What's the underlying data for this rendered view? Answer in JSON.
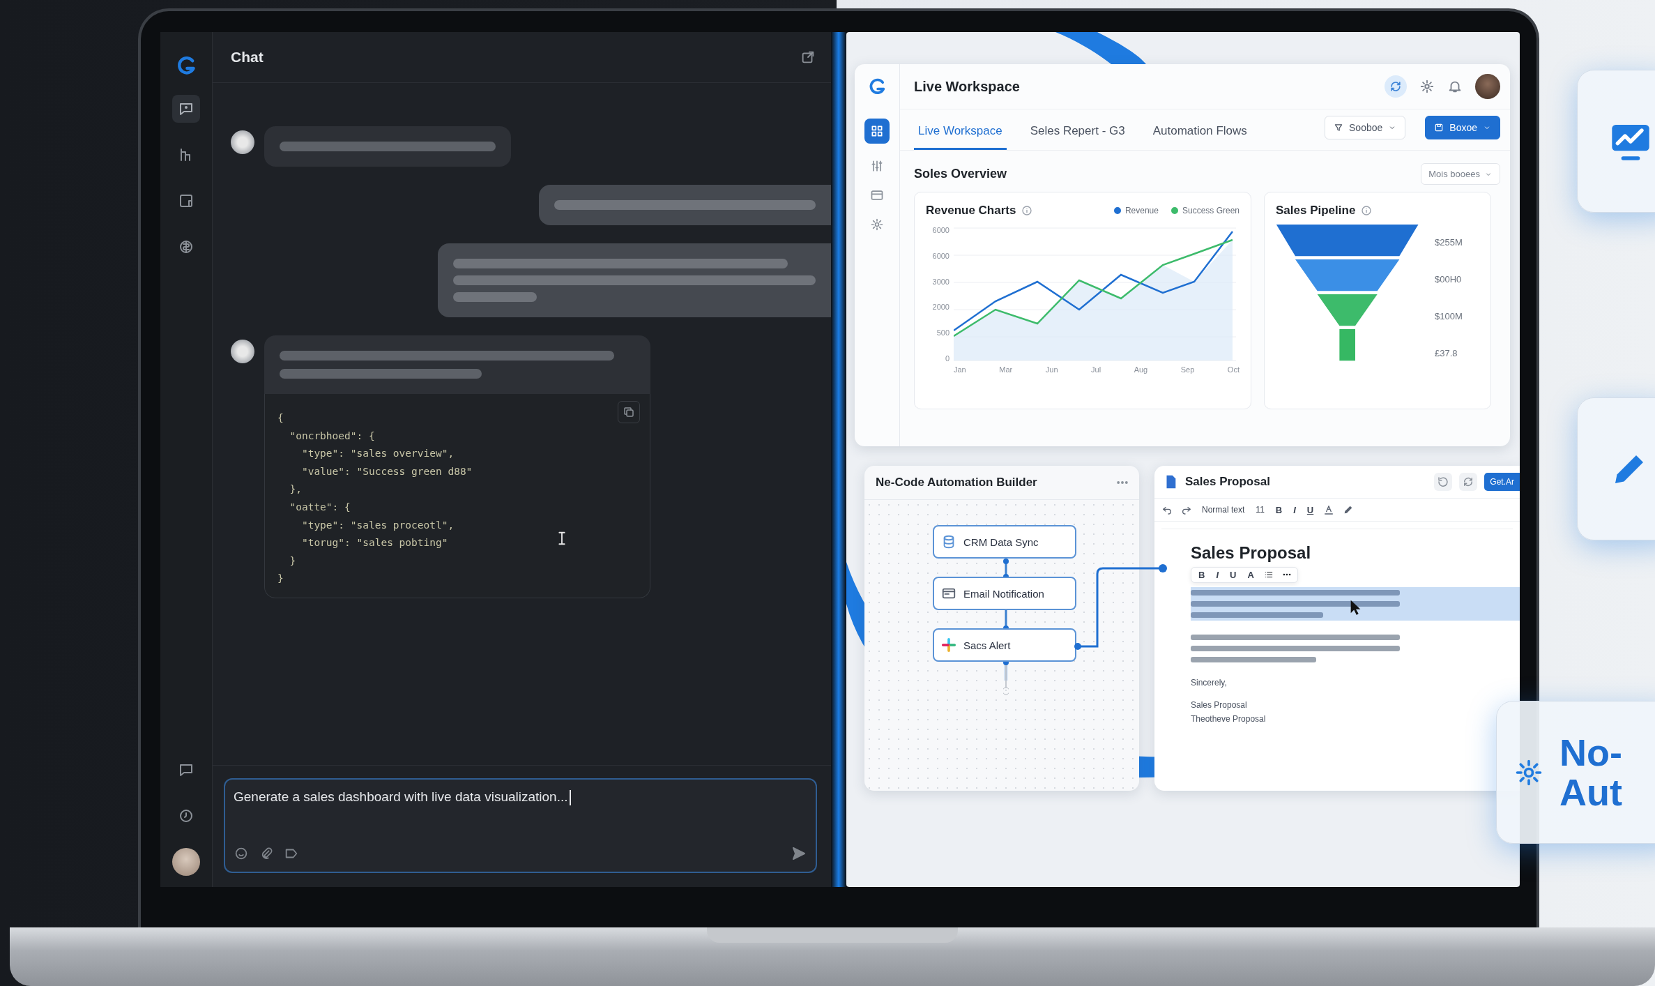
{
  "chat": {
    "title": "Chat",
    "messages": [
      {
        "kind": "assistant"
      },
      {
        "kind": "user"
      },
      {
        "kind": "user"
      },
      {
        "kind": "assistant",
        "code": [
          "{",
          "  \"oncrbhoed\": {",
          "    \"type\": \"sales overview\",",
          "    \"value\": \"Success green d88\"",
          "  },",
          "  \"oatte\": {",
          "    \"type\": \"sales proceotl\",",
          "    \"torug\": \"sales pobting\"",
          "  }",
          "}"
        ]
      }
    ],
    "composer": {
      "value": "Generate a sales dashboard with live data visualization..."
    }
  },
  "workspace": {
    "title": "Live Workspace",
    "tabs": [
      {
        "label": "Live Workspace",
        "selected": true
      },
      {
        "label": "Seles Repert - G3",
        "selected": false
      },
      {
        "label": "Automation Flows",
        "selected": false
      }
    ],
    "filter_button": "Sooboe",
    "primary_button": "Boxoe",
    "section_title": "Soles Overview",
    "section_select": "Mois booees",
    "revenue": {
      "title": "Revenue Charts",
      "legend": [
        {
          "label": "Revenue",
          "color": "#1f6fd1"
        },
        {
          "label": "Success Green",
          "color": "#3dbb6b"
        }
      ],
      "y_labels": [
        "6000",
        "6000",
        "3000",
        "2000",
        "500",
        "0"
      ],
      "x_labels": [
        "Jan",
        "Mar",
        "Jun",
        "Jul",
        "Aug",
        "Sep",
        "Oct"
      ]
    },
    "pipeline": {
      "title": "Sales Pipeline",
      "stages": [
        {
          "label": "$255M",
          "color": "#1f6fd1"
        },
        {
          "label": "$00H0",
          "color": "#3b8fe6"
        },
        {
          "label": "$100M",
          "color": "#3dbb6b"
        },
        {
          "label": "£37.8",
          "color": "#36b863"
        }
      ]
    },
    "automation": {
      "title": "Ne-Code Automation Builder",
      "nodes": [
        {
          "label": "CRM Data Sync",
          "kind": "database"
        },
        {
          "label": "Email Notification",
          "kind": "email"
        },
        {
          "label": "Sacs Alert",
          "kind": "chat"
        }
      ]
    },
    "document": {
      "title": "Sales Proposal",
      "action_button": "Get.Ar",
      "font": "Normal text",
      "size": "11",
      "format": [
        "B",
        "I",
        "U"
      ],
      "heading": "Sales Proposal",
      "float_format": [
        "B",
        "I",
        "U",
        "A"
      ],
      "closing": [
        "Sincerely,",
        "Sales Proposal",
        "Theotheve Proposal"
      ]
    }
  },
  "features": [
    {
      "kind": "chart"
    },
    {
      "kind": "pencil"
    },
    {
      "kind": "automation",
      "lines": [
        "No-",
        "Aut"
      ]
    }
  ]
}
